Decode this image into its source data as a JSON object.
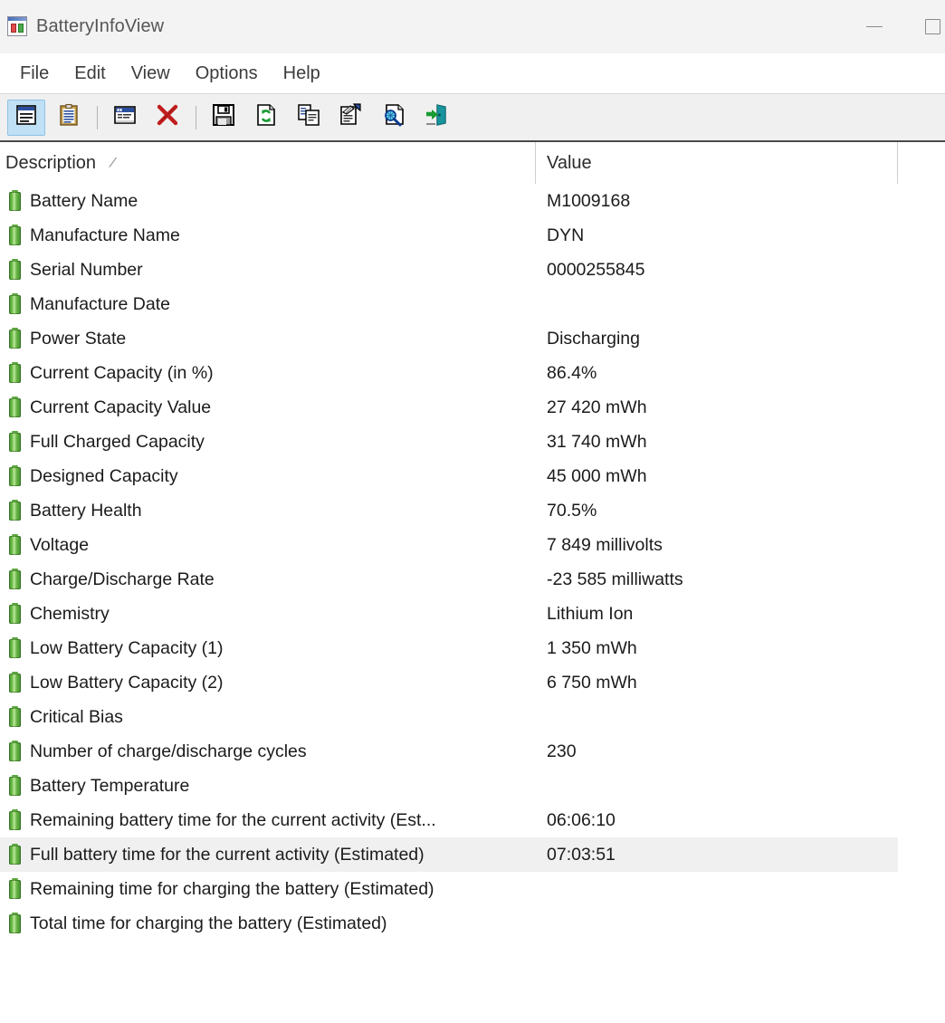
{
  "window": {
    "title": "BatteryInfoView",
    "icon": "battery-app-icon",
    "controls": {
      "minimize": "minimize-button",
      "maximize": "maximize-button"
    }
  },
  "menubar": {
    "items": [
      {
        "label": "File"
      },
      {
        "label": "Edit"
      },
      {
        "label": "View"
      },
      {
        "label": "Options"
      },
      {
        "label": "Help"
      }
    ]
  },
  "toolbar": {
    "buttons": [
      {
        "name": "properties-view-icon",
        "active": true
      },
      {
        "name": "clipboard-icon",
        "active": false
      },
      {
        "name": "separator-1",
        "separator": true
      },
      {
        "name": "properties-window-icon",
        "active": false
      },
      {
        "name": "delete-red-x-icon",
        "active": false
      },
      {
        "name": "separator-2",
        "separator": true
      },
      {
        "name": "save-floppy-icon",
        "active": false
      },
      {
        "name": "refresh-icon",
        "active": false
      },
      {
        "name": "copy-icon",
        "active": false
      },
      {
        "name": "html-report-icon",
        "active": false
      },
      {
        "name": "find-icon",
        "active": false
      },
      {
        "name": "exit-door-icon",
        "active": false
      }
    ]
  },
  "list": {
    "columns": [
      {
        "label": "Description",
        "sort_indicator": "/"
      },
      {
        "label": "Value"
      }
    ],
    "rows": [
      {
        "description": "Battery Name",
        "value": "M1009168",
        "selected": false
      },
      {
        "description": "Manufacture Name",
        "value": "DYN",
        "selected": false
      },
      {
        "description": "Serial Number",
        "value": "0000255845",
        "selected": false
      },
      {
        "description": "Manufacture Date",
        "value": "",
        "selected": false
      },
      {
        "description": "Power State",
        "value": "Discharging",
        "selected": false
      },
      {
        "description": "Current Capacity (in %)",
        "value": "86.4%",
        "selected": false
      },
      {
        "description": "Current Capacity Value",
        "value": "27 420 mWh",
        "selected": false
      },
      {
        "description": "Full Charged Capacity",
        "value": "31 740 mWh",
        "selected": false
      },
      {
        "description": "Designed Capacity",
        "value": "45 000 mWh",
        "selected": false
      },
      {
        "description": "Battery Health",
        "value": "70.5%",
        "selected": false
      },
      {
        "description": "Voltage",
        "value": "7 849 millivolts",
        "selected": false
      },
      {
        "description": "Charge/Discharge Rate",
        "value": "-23 585 milliwatts",
        "selected": false
      },
      {
        "description": "Chemistry",
        "value": "Lithium Ion",
        "selected": false
      },
      {
        "description": "Low Battery Capacity (1)",
        "value": "1 350 mWh",
        "selected": false
      },
      {
        "description": "Low Battery Capacity (2)",
        "value": "6 750 mWh",
        "selected": false
      },
      {
        "description": "Critical Bias",
        "value": "",
        "selected": false
      },
      {
        "description": "Number of charge/discharge cycles",
        "value": "230",
        "selected": false
      },
      {
        "description": "Battery Temperature",
        "value": "",
        "selected": false
      },
      {
        "description": "Remaining battery time for the current activity (Est...",
        "value": "06:06:10",
        "selected": false
      },
      {
        "description": "Full battery time for the current activity (Estimated)",
        "value": "07:03:51",
        "selected": true
      },
      {
        "description": "Remaining time for charging the battery (Estimated)",
        "value": "",
        "selected": false
      },
      {
        "description": "Total  time for charging the battery (Estimated)",
        "value": "",
        "selected": false
      }
    ]
  },
  "colors": {
    "titlebar_bg": "#f3f3f3",
    "toolbar_bg": "#f0f0f0",
    "selection_bg": "#f0f0f0",
    "battery_green": "#5aa83c",
    "accent_blue": "#bfe0f5"
  }
}
